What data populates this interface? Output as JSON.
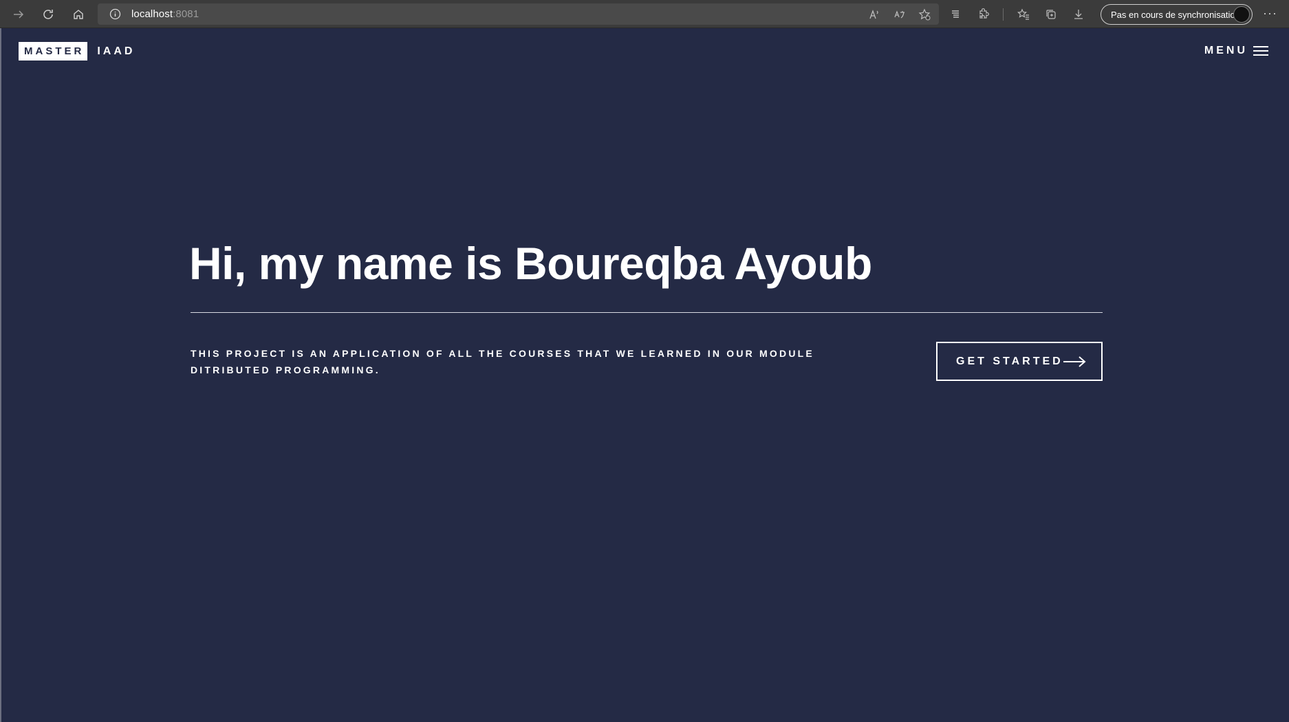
{
  "browser": {
    "url_host": "localhost",
    "url_port": ":8081",
    "sync_label": "Pas en cours de synchronisation",
    "more_label": "···"
  },
  "header": {
    "brand_box": "MASTER",
    "brand_text": "IAAD",
    "menu_label": "MENU"
  },
  "hero": {
    "title": "Hi, my name is Boureqba Ayoub",
    "description": "THIS PROJECT IS AN APPLICATION OF ALL THE COURSES THAT WE LEARNED IN OUR MODULE DITRIBUTED PROGRAMMING.",
    "cta_label": "GET STARTED"
  },
  "colors": {
    "background": "#242a45",
    "text": "#ffffff"
  },
  "icons": [
    "forward-icon",
    "reload-icon",
    "home-icon",
    "info-icon",
    "read-aloud-icon",
    "translate-icon",
    "add-favorite-icon",
    "reading-view-icon",
    "extensions-icon",
    "favorites-icon",
    "collections-icon",
    "download-icon",
    "hamburger-icon",
    "arrow-right-icon"
  ]
}
